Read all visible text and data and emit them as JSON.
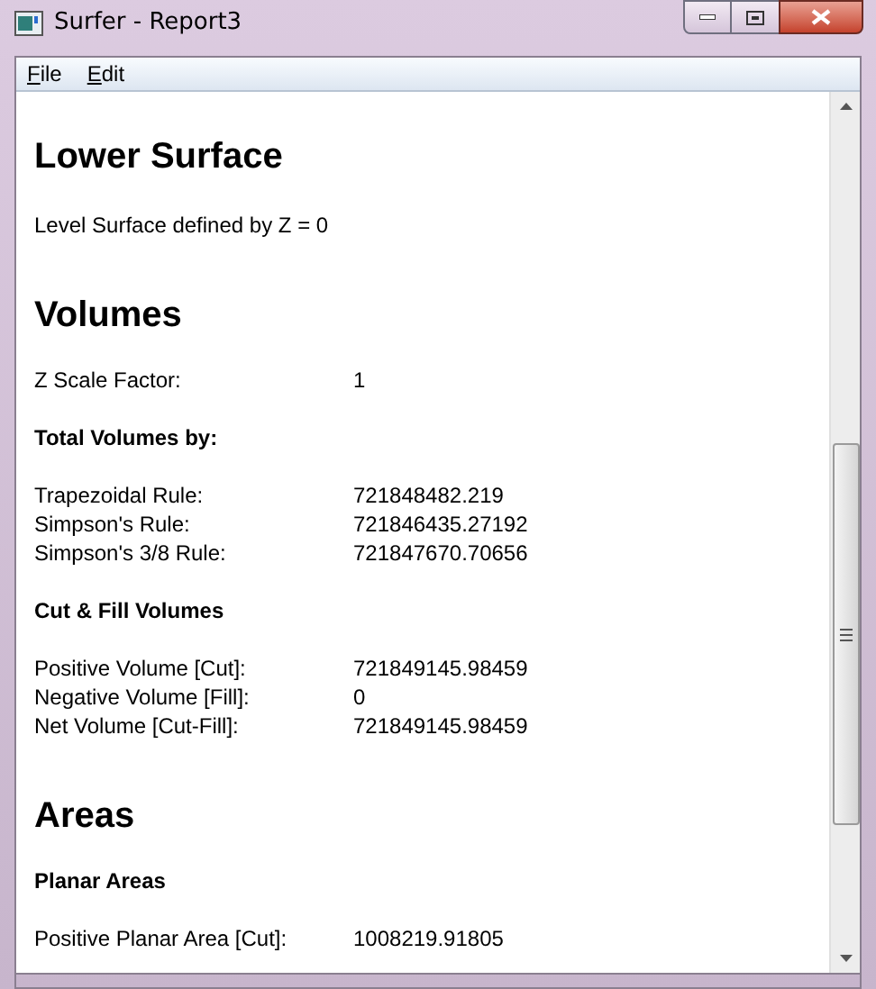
{
  "window": {
    "title": "Surfer - Report3"
  },
  "menu": [
    {
      "label": "File"
    },
    {
      "label": "Edit"
    }
  ],
  "sections": [
    {
      "heading": "Lower Surface",
      "blocks": [
        {
          "kind": "text",
          "text": "Level Surface defined by Z = 0"
        }
      ]
    },
    {
      "heading": "Volumes",
      "blocks": [
        {
          "kind": "rows",
          "rows": [
            {
              "label": "Z Scale Factor:",
              "value": "1"
            }
          ]
        },
        {
          "kind": "subheading",
          "text": "Total Volumes by:"
        },
        {
          "kind": "rows",
          "rows": [
            {
              "label": "Trapezoidal Rule:",
              "value": "721848482.219"
            },
            {
              "label": "Simpson's Rule:",
              "value": "721846435.27192"
            },
            {
              "label": "Simpson's 3/8 Rule:",
              "value": "721847670.70656"
            }
          ]
        },
        {
          "kind": "subheading",
          "text": "Cut & Fill Volumes"
        },
        {
          "kind": "rows",
          "rows": [
            {
              "label": "Positive Volume [Cut]:",
              "value": "721849145.98459"
            },
            {
              "label": "Negative Volume [Fill]:",
              "value": "0"
            },
            {
              "label": "Net Volume [Cut-Fill]:",
              "value": "721849145.98459"
            }
          ]
        }
      ]
    },
    {
      "heading": "Areas",
      "blocks": [
        {
          "kind": "subheading",
          "text": "Planar Areas"
        },
        {
          "kind": "rows",
          "rows": [
            {
              "label": "Positive Planar Area [Cut]:",
              "value": "1008219.91805"
            }
          ]
        }
      ]
    }
  ]
}
